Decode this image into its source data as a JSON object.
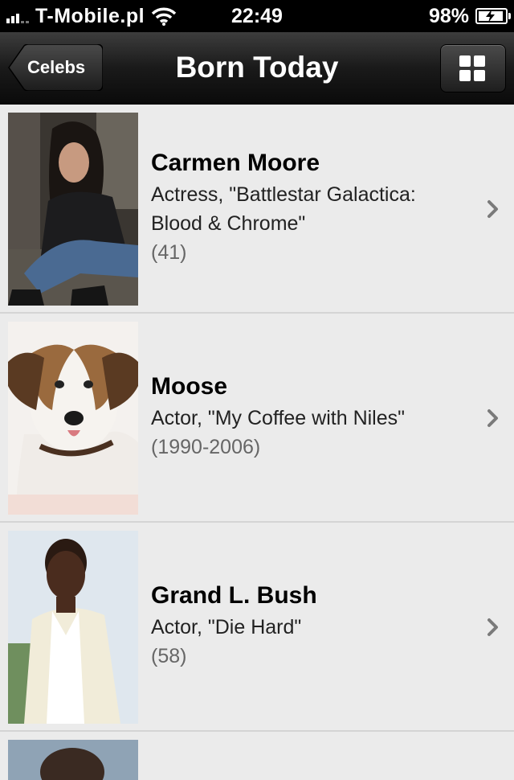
{
  "status_bar": {
    "carrier": "T-Mobile.pl",
    "time": "22:49",
    "battery": "98%"
  },
  "nav": {
    "back_label": "Celebs",
    "title": "Born Today",
    "grid_icon": "grid-icon"
  },
  "celebs": [
    {
      "name": "Carmen Moore",
      "role": "Actress, \"Battlestar Galactica: Blood & Chrome\"",
      "years": "(41)"
    },
    {
      "name": "Moose",
      "role": "Actor, \"My Coffee with Niles\"",
      "years": "(1990-2006)"
    },
    {
      "name": "Grand L. Bush",
      "role": "Actor, \"Die Hard\"",
      "years": "(58)"
    }
  ]
}
